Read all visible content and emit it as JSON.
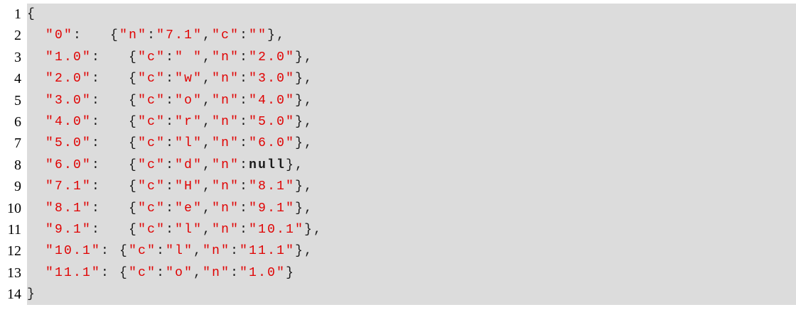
{
  "lines": [
    {
      "no": "1",
      "tokens": [
        {
          "t": "{",
          "k": "punc"
        }
      ]
    },
    {
      "no": "2",
      "indent": 2,
      "tokens": [
        {
          "t": "\"0\"",
          "k": "str"
        },
        {
          "t": ":   ",
          "k": "punc"
        },
        {
          "t": "{",
          "k": "punc"
        },
        {
          "t": "\"n\"",
          "k": "str"
        },
        {
          "t": ":",
          "k": "punc"
        },
        {
          "t": "\"7.1\"",
          "k": "str"
        },
        {
          "t": ",",
          "k": "punc"
        },
        {
          "t": "\"c\"",
          "k": "str"
        },
        {
          "t": ":",
          "k": "punc"
        },
        {
          "t": "\"\"",
          "k": "str"
        },
        {
          "t": "},",
          "k": "punc"
        }
      ]
    },
    {
      "no": "3",
      "indent": 2,
      "tokens": [
        {
          "t": "\"1.0\"",
          "k": "str"
        },
        {
          "t": ":   ",
          "k": "punc"
        },
        {
          "t": "{",
          "k": "punc"
        },
        {
          "t": "\"c\"",
          "k": "str"
        },
        {
          "t": ":",
          "k": "punc"
        },
        {
          "t": "\" \"",
          "k": "str"
        },
        {
          "t": ",",
          "k": "punc"
        },
        {
          "t": "\"n\"",
          "k": "str"
        },
        {
          "t": ":",
          "k": "punc"
        },
        {
          "t": "\"2.0\"",
          "k": "str"
        },
        {
          "t": "},",
          "k": "punc"
        }
      ]
    },
    {
      "no": "4",
      "indent": 2,
      "tokens": [
        {
          "t": "\"2.0\"",
          "k": "str"
        },
        {
          "t": ":   ",
          "k": "punc"
        },
        {
          "t": "{",
          "k": "punc"
        },
        {
          "t": "\"c\"",
          "k": "str"
        },
        {
          "t": ":",
          "k": "punc"
        },
        {
          "t": "\"w\"",
          "k": "str"
        },
        {
          "t": ",",
          "k": "punc"
        },
        {
          "t": "\"n\"",
          "k": "str"
        },
        {
          "t": ":",
          "k": "punc"
        },
        {
          "t": "\"3.0\"",
          "k": "str"
        },
        {
          "t": "},",
          "k": "punc"
        }
      ]
    },
    {
      "no": "5",
      "indent": 2,
      "tokens": [
        {
          "t": "\"3.0\"",
          "k": "str"
        },
        {
          "t": ":   ",
          "k": "punc"
        },
        {
          "t": "{",
          "k": "punc"
        },
        {
          "t": "\"c\"",
          "k": "str"
        },
        {
          "t": ":",
          "k": "punc"
        },
        {
          "t": "\"o\"",
          "k": "str"
        },
        {
          "t": ",",
          "k": "punc"
        },
        {
          "t": "\"n\"",
          "k": "str"
        },
        {
          "t": ":",
          "k": "punc"
        },
        {
          "t": "\"4.0\"",
          "k": "str"
        },
        {
          "t": "},",
          "k": "punc"
        }
      ]
    },
    {
      "no": "6",
      "indent": 2,
      "tokens": [
        {
          "t": "\"4.0\"",
          "k": "str"
        },
        {
          "t": ":   ",
          "k": "punc"
        },
        {
          "t": "{",
          "k": "punc"
        },
        {
          "t": "\"c\"",
          "k": "str"
        },
        {
          "t": ":",
          "k": "punc"
        },
        {
          "t": "\"r\"",
          "k": "str"
        },
        {
          "t": ",",
          "k": "punc"
        },
        {
          "t": "\"n\"",
          "k": "str"
        },
        {
          "t": ":",
          "k": "punc"
        },
        {
          "t": "\"5.0\"",
          "k": "str"
        },
        {
          "t": "},",
          "k": "punc"
        }
      ]
    },
    {
      "no": "7",
      "indent": 2,
      "tokens": [
        {
          "t": "\"5.0\"",
          "k": "str"
        },
        {
          "t": ":   ",
          "k": "punc"
        },
        {
          "t": "{",
          "k": "punc"
        },
        {
          "t": "\"c\"",
          "k": "str"
        },
        {
          "t": ":",
          "k": "punc"
        },
        {
          "t": "\"l\"",
          "k": "str"
        },
        {
          "t": ",",
          "k": "punc"
        },
        {
          "t": "\"n\"",
          "k": "str"
        },
        {
          "t": ":",
          "k": "punc"
        },
        {
          "t": "\"6.0\"",
          "k": "str"
        },
        {
          "t": "},",
          "k": "punc"
        }
      ]
    },
    {
      "no": "8",
      "indent": 2,
      "tokens": [
        {
          "t": "\"6.0\"",
          "k": "str"
        },
        {
          "t": ":   ",
          "k": "punc"
        },
        {
          "t": "{",
          "k": "punc"
        },
        {
          "t": "\"c\"",
          "k": "str"
        },
        {
          "t": ":",
          "k": "punc"
        },
        {
          "t": "\"d\"",
          "k": "str"
        },
        {
          "t": ",",
          "k": "punc"
        },
        {
          "t": "\"n\"",
          "k": "str"
        },
        {
          "t": ":",
          "k": "punc"
        },
        {
          "t": "null",
          "k": "lit"
        },
        {
          "t": "},",
          "k": "punc"
        }
      ]
    },
    {
      "no": "9",
      "indent": 2,
      "tokens": [
        {
          "t": "\"7.1\"",
          "k": "str"
        },
        {
          "t": ":   ",
          "k": "punc"
        },
        {
          "t": "{",
          "k": "punc"
        },
        {
          "t": "\"c\"",
          "k": "str"
        },
        {
          "t": ":",
          "k": "punc"
        },
        {
          "t": "\"H\"",
          "k": "str"
        },
        {
          "t": ",",
          "k": "punc"
        },
        {
          "t": "\"n\"",
          "k": "str"
        },
        {
          "t": ":",
          "k": "punc"
        },
        {
          "t": "\"8.1\"",
          "k": "str"
        },
        {
          "t": "},",
          "k": "punc"
        }
      ]
    },
    {
      "no": "10",
      "indent": 2,
      "tokens": [
        {
          "t": "\"8.1\"",
          "k": "str"
        },
        {
          "t": ":   ",
          "k": "punc"
        },
        {
          "t": "{",
          "k": "punc"
        },
        {
          "t": "\"c\"",
          "k": "str"
        },
        {
          "t": ":",
          "k": "punc"
        },
        {
          "t": "\"e\"",
          "k": "str"
        },
        {
          "t": ",",
          "k": "punc"
        },
        {
          "t": "\"n\"",
          "k": "str"
        },
        {
          "t": ":",
          "k": "punc"
        },
        {
          "t": "\"9.1\"",
          "k": "str"
        },
        {
          "t": "},",
          "k": "punc"
        }
      ]
    },
    {
      "no": "11",
      "indent": 2,
      "tokens": [
        {
          "t": "\"9.1\"",
          "k": "str"
        },
        {
          "t": ":   ",
          "k": "punc"
        },
        {
          "t": "{",
          "k": "punc"
        },
        {
          "t": "\"c\"",
          "k": "str"
        },
        {
          "t": ":",
          "k": "punc"
        },
        {
          "t": "\"l\"",
          "k": "str"
        },
        {
          "t": ",",
          "k": "punc"
        },
        {
          "t": "\"n\"",
          "k": "str"
        },
        {
          "t": ":",
          "k": "punc"
        },
        {
          "t": "\"10.1\"",
          "k": "str"
        },
        {
          "t": "},",
          "k": "punc"
        }
      ]
    },
    {
      "no": "12",
      "indent": 2,
      "tokens": [
        {
          "t": "\"10.1\"",
          "k": "str"
        },
        {
          "t": ": ",
          "k": "punc"
        },
        {
          "t": "{",
          "k": "punc"
        },
        {
          "t": "\"c\"",
          "k": "str"
        },
        {
          "t": ":",
          "k": "punc"
        },
        {
          "t": "\"l\"",
          "k": "str"
        },
        {
          "t": ",",
          "k": "punc"
        },
        {
          "t": "\"n\"",
          "k": "str"
        },
        {
          "t": ":",
          "k": "punc"
        },
        {
          "t": "\"11.1\"",
          "k": "str"
        },
        {
          "t": "},",
          "k": "punc"
        }
      ]
    },
    {
      "no": "13",
      "indent": 2,
      "tokens": [
        {
          "t": "\"11.1\"",
          "k": "str"
        },
        {
          "t": ": ",
          "k": "punc"
        },
        {
          "t": "{",
          "k": "punc"
        },
        {
          "t": "\"c\"",
          "k": "str"
        },
        {
          "t": ":",
          "k": "punc"
        },
        {
          "t": "\"o\"",
          "k": "str"
        },
        {
          "t": ",",
          "k": "punc"
        },
        {
          "t": "\"n\"",
          "k": "str"
        },
        {
          "t": ":",
          "k": "punc"
        },
        {
          "t": "\"1.0\"",
          "k": "str"
        },
        {
          "t": "}",
          "k": "punc"
        }
      ]
    },
    {
      "no": "14",
      "tokens": [
        {
          "t": "}",
          "k": "punc"
        }
      ]
    }
  ]
}
